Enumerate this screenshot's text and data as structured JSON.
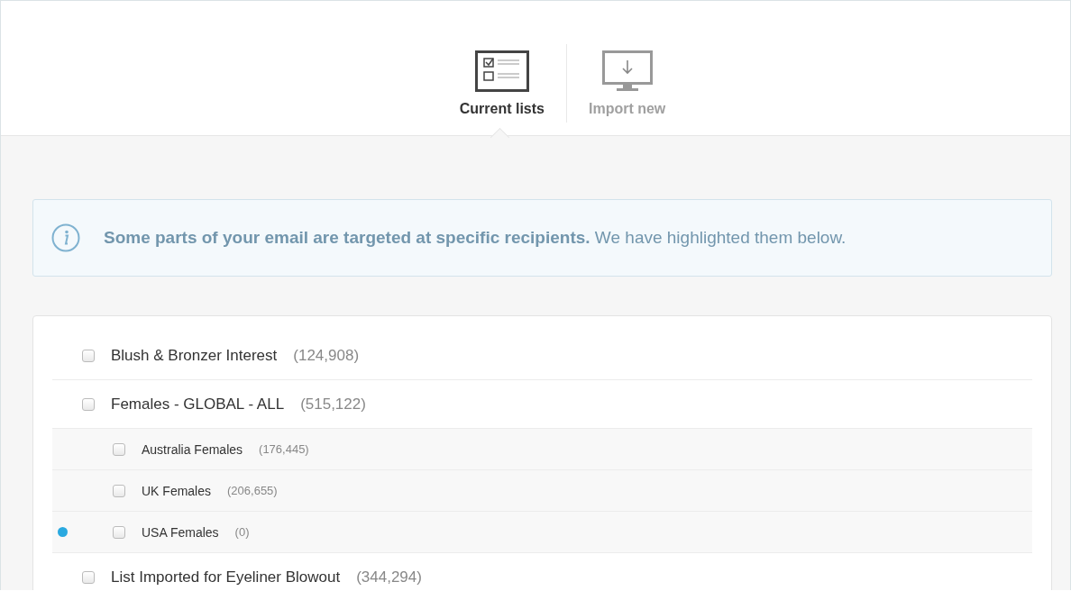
{
  "tabs": [
    {
      "label": "Current lists",
      "selected": true,
      "kind": "lists"
    },
    {
      "label": "Import new",
      "selected": false,
      "kind": "import"
    }
  ],
  "notice": {
    "text": "**Some parts of your email are targeted at specific recipients.** We have highlighted them below."
  },
  "lists": [
    {
      "name": "Blush & Bronzer Interest",
      "count": "(124,908)",
      "checked": false,
      "targeted": false
    },
    {
      "name": "Females - GLOBAL - ALL",
      "count": "(515,122)",
      "checked": false,
      "targeted": false,
      "children": [
        {
          "name": "Australia Females",
          "count": "(176,445)",
          "checked": false,
          "targeted": false
        },
        {
          "name": "UK Females",
          "count": "(206,655)",
          "checked": false,
          "targeted": false
        },
        {
          "name": "USA Females",
          "count": "(0)",
          "checked": false,
          "targeted": true
        }
      ]
    },
    {
      "name": "List Imported for Eyeliner Blowout",
      "count": "(344,294)",
      "checked": false,
      "targeted": false
    }
  ]
}
